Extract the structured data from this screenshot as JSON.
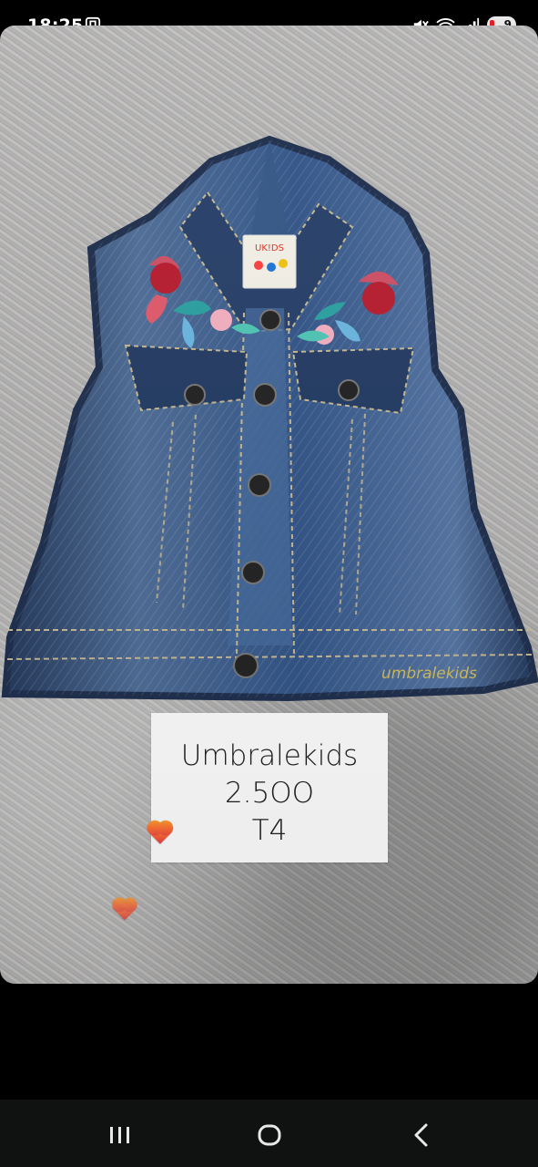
{
  "status_bar": {
    "time": "18:25",
    "battery_level": "9",
    "icons": [
      "screen-record-icon",
      "mute-icon",
      "wifi-icon",
      "signal-icon",
      "battery-icon"
    ]
  },
  "post": {
    "label_lines": [
      "Umbralekids",
      "2.5OO",
      "T4"
    ],
    "vest_brand_embroidery": "umbralekids",
    "vest_tag_text": "UK!DS"
  },
  "navigation": {
    "buttons": [
      "recent-apps-icon",
      "home-icon",
      "back-icon"
    ]
  },
  "colors": {
    "background": "#000000",
    "navigation_background": "#101111",
    "denim": "#2f4d78",
    "heart": "#ff7a2e"
  }
}
